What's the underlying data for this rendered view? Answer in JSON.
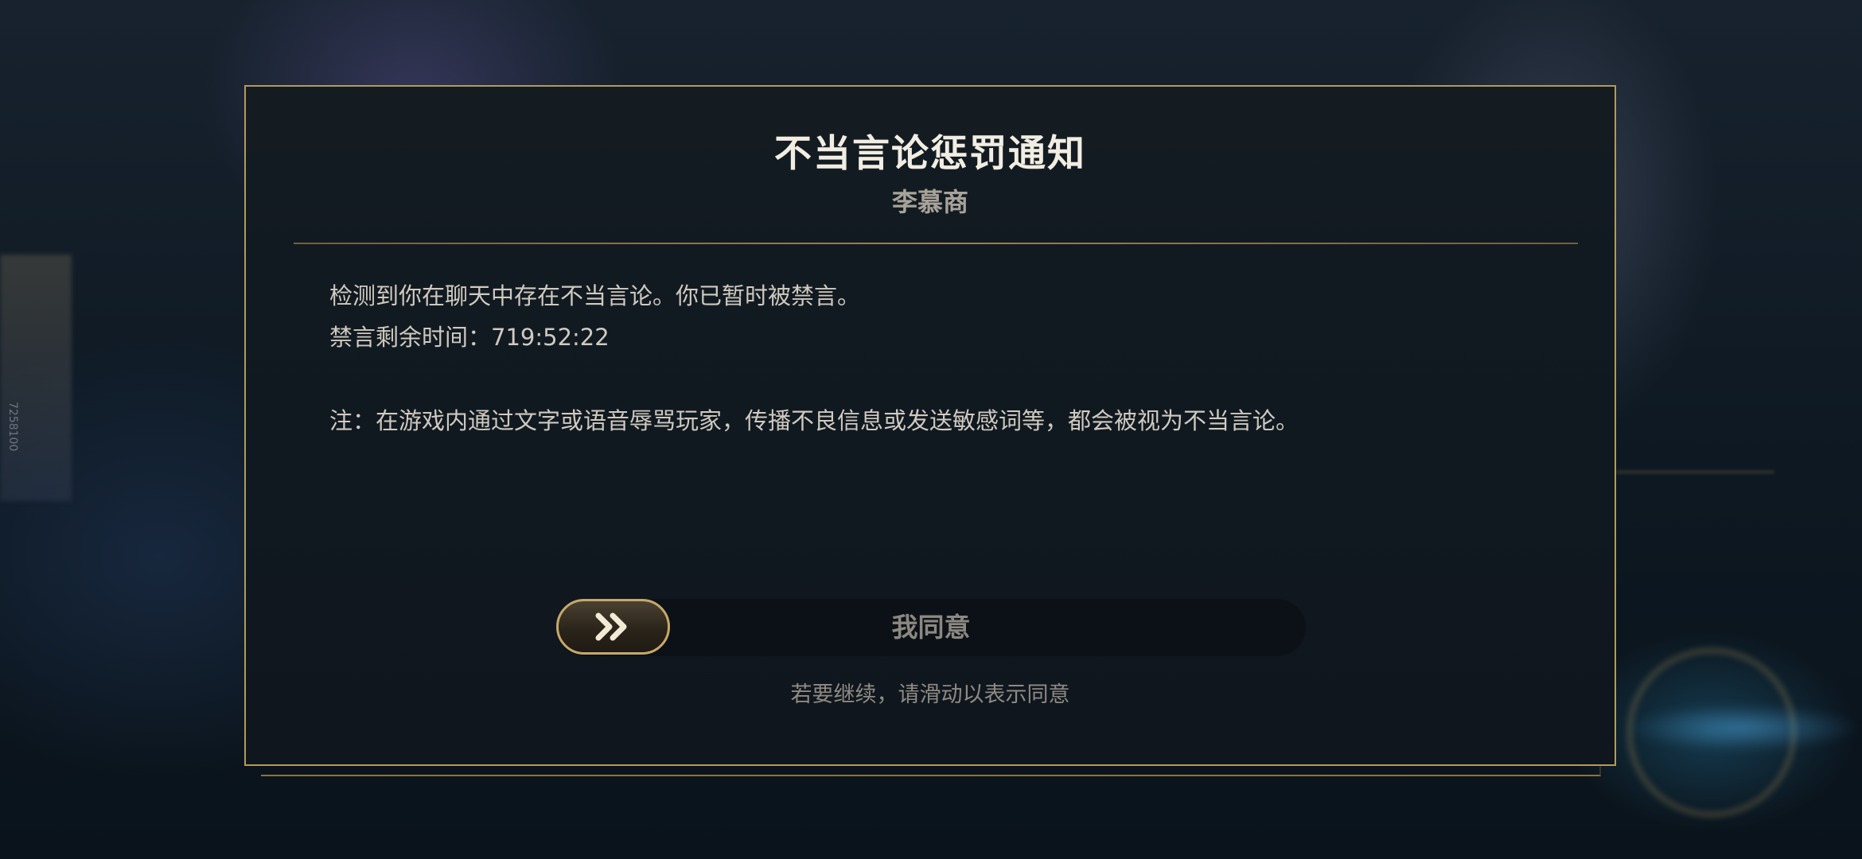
{
  "background": {
    "side_label": "7258100"
  },
  "dialog": {
    "title": "不当言论惩罚通知",
    "player_name": "李慕商",
    "message": "检测到你在聊天中存在不当言论。你已暂时被禁言。",
    "remaining_label": "禁言剩余时间：",
    "remaining_time": "719:52:22",
    "note": "注：在游戏内通过文字或语音辱骂玩家，传播不良信息或发送敏感词等，都会被视为不当言论。",
    "slider": {
      "label": "我同意",
      "knob_icon": "double-chevron-right-icon"
    },
    "hint": "若要继续，请滑动以表示同意"
  },
  "colors": {
    "border_gold": "#b29a5e",
    "knob_gold": "#c7a86a",
    "panel_bg": "#121a21"
  }
}
